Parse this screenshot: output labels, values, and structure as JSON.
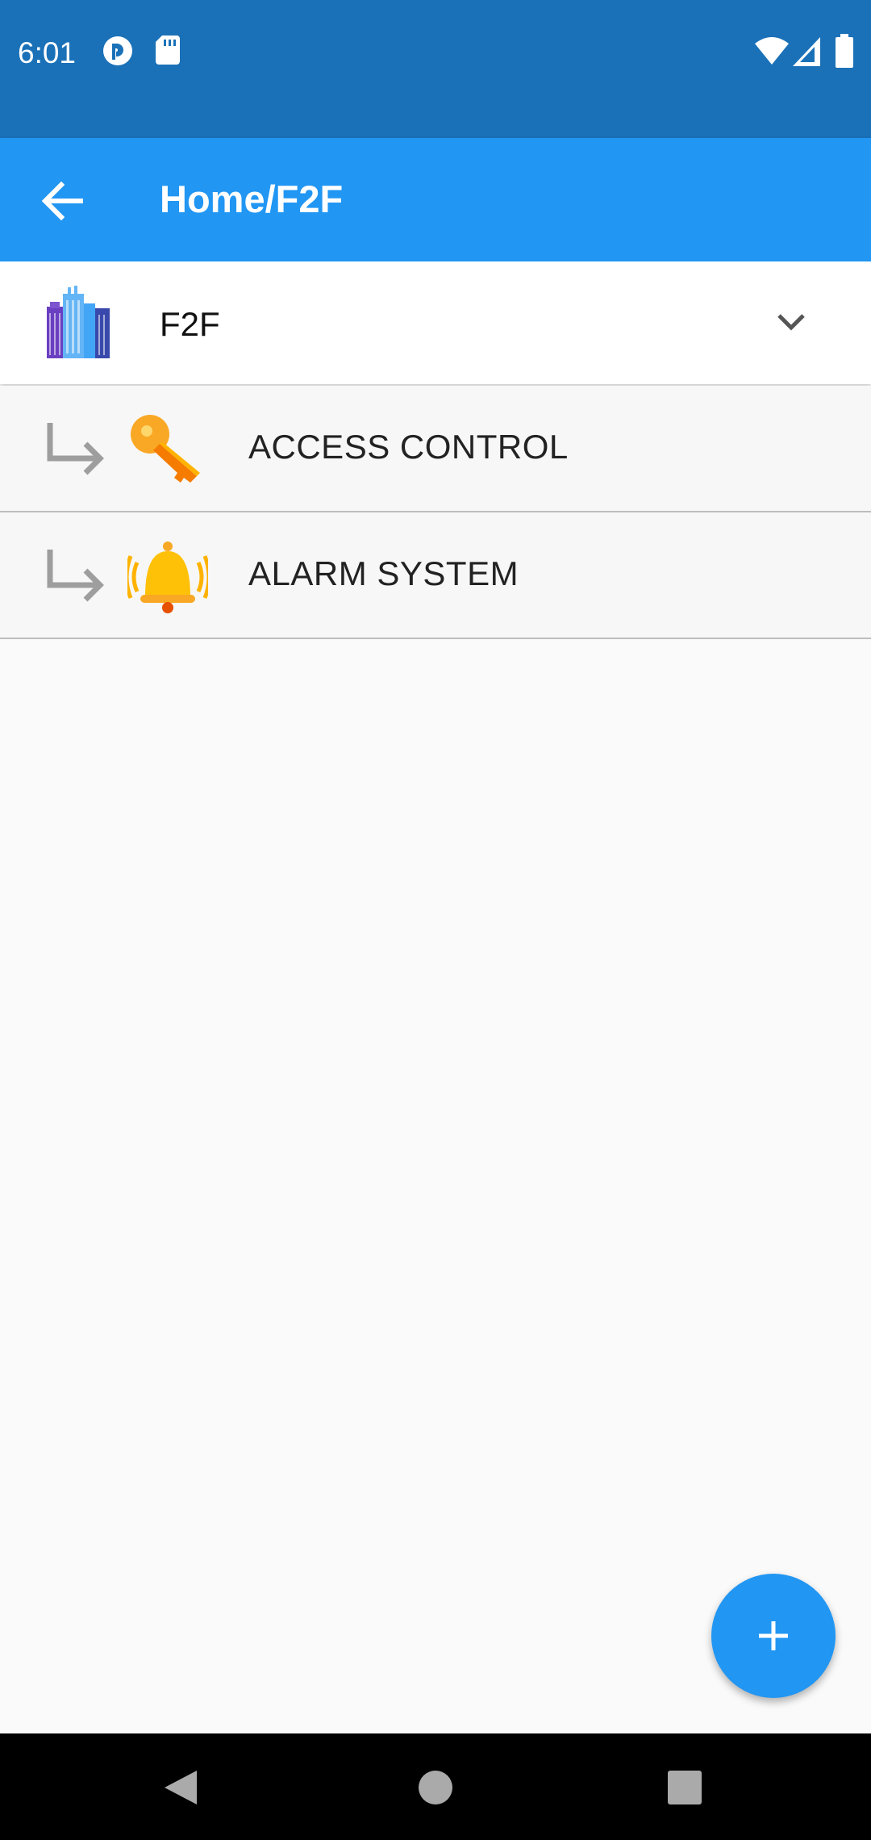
{
  "status_bar": {
    "time": "6:01",
    "left_icons": [
      "sync-icon",
      "sd-card-icon"
    ],
    "right_icons": [
      "wifi-icon",
      "signal-icon",
      "battery-icon"
    ]
  },
  "app_bar": {
    "back_icon": "arrow-back-icon",
    "title": "Home/F2F"
  },
  "header": {
    "icon": "building-icon",
    "label": "F2F",
    "expand_icon": "chevron-down-icon"
  },
  "items": [
    {
      "arrow_icon": "subdirectory-arrow-icon",
      "icon": "key-icon",
      "label": "ACCESS CONTROL"
    },
    {
      "arrow_icon": "subdirectory-arrow-icon",
      "icon": "bell-icon",
      "label": "ALARM SYSTEM"
    }
  ],
  "fab": {
    "icon": "plus-icon"
  },
  "nav_bar": {
    "buttons": [
      "back-triangle-icon",
      "home-circle-icon",
      "recents-square-icon"
    ]
  },
  "colors": {
    "status_bar": "#1a71b8",
    "app_bar": "#2196f3",
    "accent": "#2196f3",
    "background": "#fafafa",
    "divider": "#bdbdbd"
  }
}
